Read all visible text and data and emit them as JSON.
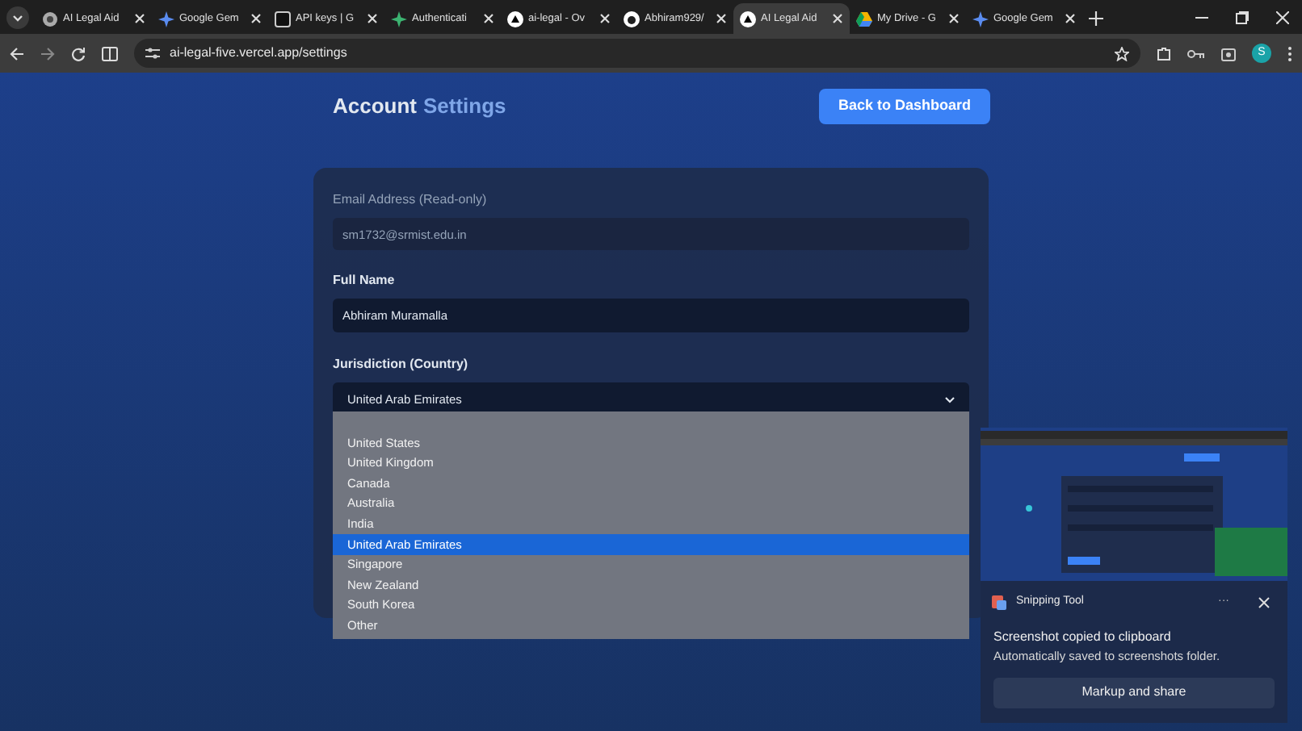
{
  "browser": {
    "tabs": [
      {
        "title": "AI Legal Aid",
        "selected": false
      },
      {
        "title": "Google Gem",
        "selected": false
      },
      {
        "title": "API keys | G",
        "selected": false
      },
      {
        "title": "Authenticati",
        "selected": false
      },
      {
        "title": "ai-legal - Ov",
        "selected": false
      },
      {
        "title": "Abhiram929/",
        "selected": false
      },
      {
        "title": "AI Legal Aid",
        "selected": true
      },
      {
        "title": "My Drive - G",
        "selected": false
      },
      {
        "title": "Google Gem",
        "selected": false
      }
    ],
    "url": "ai-legal-five.vercel.app/settings",
    "profile_initial": "S"
  },
  "page": {
    "title_first": "Account",
    "title_second": "Settings",
    "back_button": "Back to Dashboard",
    "fields": [
      {
        "label": "Email Address (Read-only)",
        "value": "sm1732@srmist.edu.in",
        "disabled": true
      },
      {
        "label": "Full Name",
        "value": "Abhiram Muramalla",
        "disabled": false
      }
    ],
    "jurisdiction": {
      "label": "Jurisdiction (Country)",
      "value": "United Arab Emirates",
      "options": [
        {
          "label": "United States",
          "selected": false
        },
        {
          "label": "United Kingdom",
          "selected": false
        },
        {
          "label": "Canada",
          "selected": false
        },
        {
          "label": "Australia",
          "selected": false
        },
        {
          "label": "India",
          "selected": false
        },
        {
          "label": "United Arab Emirates",
          "selected": true
        },
        {
          "label": "Singapore",
          "selected": false
        },
        {
          "label": "New Zealand",
          "selected": false
        },
        {
          "label": "South Korea",
          "selected": false
        },
        {
          "label": "Other",
          "selected": false
        }
      ]
    }
  },
  "notification": {
    "app": "Snipping Tool",
    "more": "···",
    "title": "Screenshot copied to clipboard",
    "body": "Automatically saved to screenshots folder.",
    "action": "Markup and share"
  }
}
